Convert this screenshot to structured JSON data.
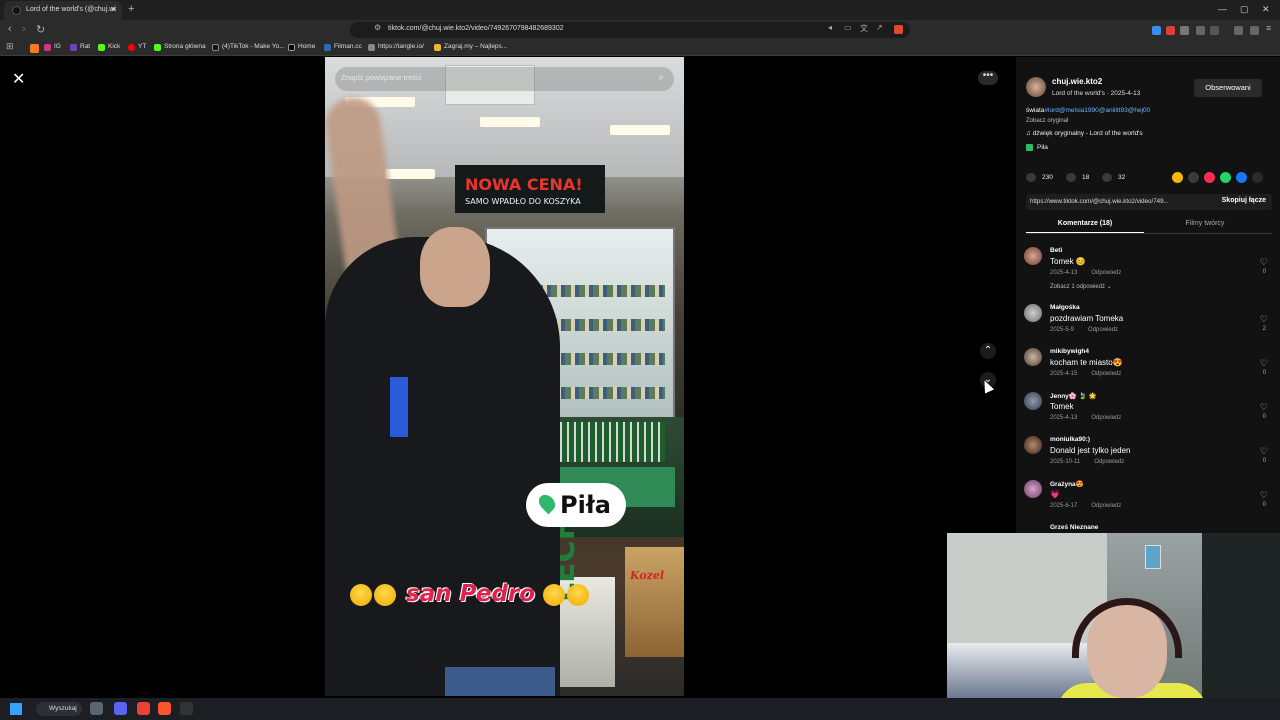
{
  "browser": {
    "tab_title": "Lord of the world's (@chuj.wi",
    "url": "tiktok.com/@chuj.wie.kto2/video/7492670798482689302",
    "bookmarks": [
      "IG",
      "Rat",
      "Kick",
      "YT",
      "Strona główna",
      "(4)TikTok - Make Yo...",
      "Home",
      "Filman.cc",
      "https://tangle.io/",
      "Zagraj.my – Najleps..."
    ]
  },
  "video": {
    "search_placeholder": "Znajdź powiązane treści",
    "banner": "NOWA CENA!",
    "banner_sub": "SAMO WPADŁO DO KOSZYKA",
    "location_sticker": "Piła",
    "caption": "san Pedro",
    "kozel_label": "Kozel",
    "lech_label": "LECH"
  },
  "creator": {
    "username": "chuj.wie.kto2",
    "subline": "Lord of the world's · 2025-4-13",
    "follow_label": "Obserwowani",
    "desc_prefix": "świata",
    "desc_tags": "#lord@melsia1990@anilitt93@hej00",
    "see_original": "Zobacz oryginał",
    "sound": "dźwięk oryginalny - Lord of the world's",
    "location": "Piła"
  },
  "stats": {
    "likes": "230",
    "comments": "18",
    "saves": "32"
  },
  "link": {
    "url": "https://www.tiktok.com/@chuj.wie.kto2/video/749...",
    "copy_label": "Skopiuj łącze"
  },
  "tabs": {
    "comments": "Komentarze (18)",
    "creator_videos": "Filmy twórcy"
  },
  "comments": [
    {
      "name": "Beti",
      "text": "Tomek 😊",
      "date": "2025-4-13",
      "reply": "Odpowiedz",
      "likes": "0",
      "more": "Zobacz 1 odpowiedź ⌄"
    },
    {
      "name": "Małgośka",
      "text": "pozdrawiam Tomeka",
      "date": "2025-5-9",
      "reply": "Odpowiedz",
      "likes": "2",
      "more": ""
    },
    {
      "name": "mikibywigh4",
      "text": "kocham te miasto😍",
      "date": "2025-4-15",
      "reply": "Odpowiedz",
      "likes": "0",
      "more": ""
    },
    {
      "name": "Jenny🌸 🍃 🌟",
      "text": "Tomek",
      "date": "2025-4-13",
      "reply": "Odpowiedz",
      "likes": "0",
      "more": ""
    },
    {
      "name": "moniulka90:)",
      "text": "Donald jest tylko jeden",
      "date": "2025-10-11",
      "reply": "Odpowiedz",
      "likes": "0",
      "more": ""
    },
    {
      "name": "Grażyna😍",
      "text": "💗",
      "date": "2025-6-17",
      "reply": "Odpowiedz",
      "likes": "0",
      "more": ""
    }
  ],
  "next_comment_name": "Grześ Nieznane",
  "taskbar": {
    "search_label": "Wyszukaj"
  }
}
